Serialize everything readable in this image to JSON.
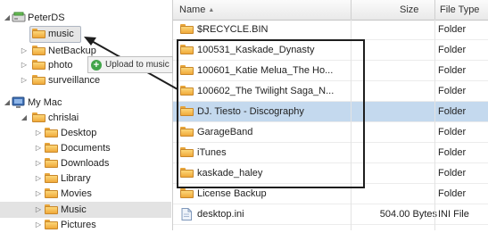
{
  "tree": {
    "items": [
      {
        "label": "PeterDS",
        "indent": 0,
        "twisty": "expanded",
        "icon": "network-drive-icon"
      },
      {
        "label": "music",
        "indent": 1,
        "twisty": "none",
        "icon": "folder-icon"
      },
      {
        "label": "NetBackup",
        "indent": 1,
        "twisty": "collapsed",
        "icon": "folder-icon"
      },
      {
        "label": "photo",
        "indent": 1,
        "twisty": "collapsed",
        "icon": "folder-icon"
      },
      {
        "label": "surveillance",
        "indent": 1,
        "twisty": "collapsed",
        "icon": "folder-icon"
      },
      {
        "label": "My Mac",
        "indent": 0,
        "twisty": "expanded",
        "icon": "computer-icon"
      },
      {
        "label": "chrislai",
        "indent": 1,
        "twisty": "expanded",
        "icon": "folder-icon"
      },
      {
        "label": "Desktop",
        "indent": 2,
        "twisty": "collapsed",
        "icon": "folder-icon"
      },
      {
        "label": "Documents",
        "indent": 2,
        "twisty": "collapsed",
        "icon": "folder-icon"
      },
      {
        "label": "Downloads",
        "indent": 2,
        "twisty": "collapsed",
        "icon": "folder-icon"
      },
      {
        "label": "Library",
        "indent": 2,
        "twisty": "collapsed",
        "icon": "folder-icon"
      },
      {
        "label": "Movies",
        "indent": 2,
        "twisty": "collapsed",
        "icon": "folder-icon"
      },
      {
        "label": "Music",
        "indent": 2,
        "twisty": "collapsed",
        "icon": "folder-icon"
      },
      {
        "label": "Pictures",
        "indent": 2,
        "twisty": "collapsed",
        "icon": "folder-icon"
      }
    ]
  },
  "tooltip": {
    "text": "Upload to music",
    "icon": "add-icon"
  },
  "list": {
    "columns": {
      "name": "Name",
      "sort_indicator": "▲",
      "size": "Size",
      "type": "File Type"
    },
    "rows": [
      {
        "name": "$RECYCLE.BIN",
        "size": "",
        "type": "Folder",
        "icon": "folder-icon"
      },
      {
        "name": "100531_Kaskade_Dynasty",
        "size": "",
        "type": "Folder",
        "icon": "folder-icon"
      },
      {
        "name": "100601_Katie Melua_The Ho...",
        "size": "",
        "type": "Folder",
        "icon": "folder-icon"
      },
      {
        "name": "100602_The Twilight Saga_N...",
        "size": "",
        "type": "Folder",
        "icon": "folder-icon"
      },
      {
        "name": "DJ. Tiesto - Discography",
        "size": "",
        "type": "Folder",
        "icon": "folder-icon",
        "selected": true
      },
      {
        "name": "GarageBand",
        "size": "",
        "type": "Folder",
        "icon": "folder-icon"
      },
      {
        "name": "iTunes",
        "size": "",
        "type": "Folder",
        "icon": "folder-icon"
      },
      {
        "name": "kaskade_haley",
        "size": "",
        "type": "Folder",
        "icon": "folder-icon"
      },
      {
        "name": "License Backup",
        "size": "",
        "type": "Folder",
        "icon": "folder-icon"
      },
      {
        "name": "desktop.ini",
        "size": "504.00 Bytes",
        "type": "INI File",
        "icon": "file-icon"
      }
    ]
  },
  "colors": {
    "selection": "#c4d9ee",
    "folder": "#f0a93a",
    "annotation": "#1e1e1e"
  }
}
